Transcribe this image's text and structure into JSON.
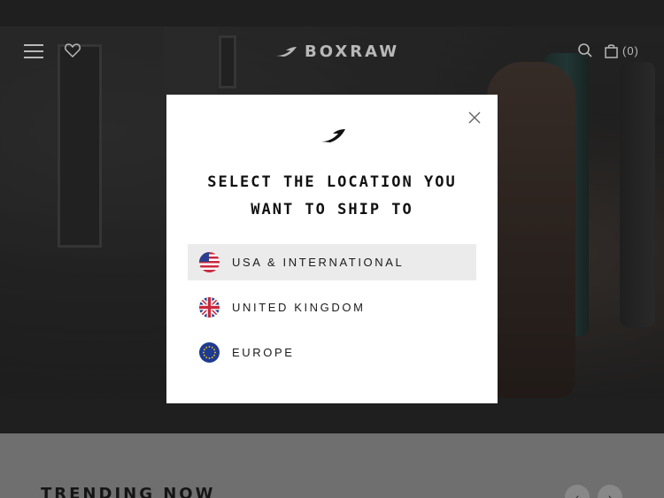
{
  "brand": {
    "name": "BOXRAW"
  },
  "header": {
    "menu_icon": "hamburger-icon",
    "wishlist_icon": "heart-icon",
    "search_icon": "search-icon",
    "cart_icon": "bag-icon",
    "cart_count": "(0)"
  },
  "modal": {
    "title_line1": "SELECT THE LOCATION YOU",
    "title_line2": "WANT TO SHIP TO",
    "close_icon": "close-icon",
    "options": [
      {
        "label": "USA & INTERNATIONAL",
        "flag": "us-flag-icon",
        "selected": true
      },
      {
        "label": "UNITED KINGDOM",
        "flag": "uk-flag-icon",
        "selected": false
      },
      {
        "label": "EUROPE",
        "flag": "eu-flag-icon",
        "selected": false
      }
    ]
  },
  "section": {
    "heading": "TRENDING NOW",
    "prev_icon": "chevron-left-icon",
    "next_icon": "chevron-right-icon"
  },
  "colors": {
    "modal_bg": "#ffffff",
    "selected_row": "#ebebeb",
    "text": "#111111"
  }
}
